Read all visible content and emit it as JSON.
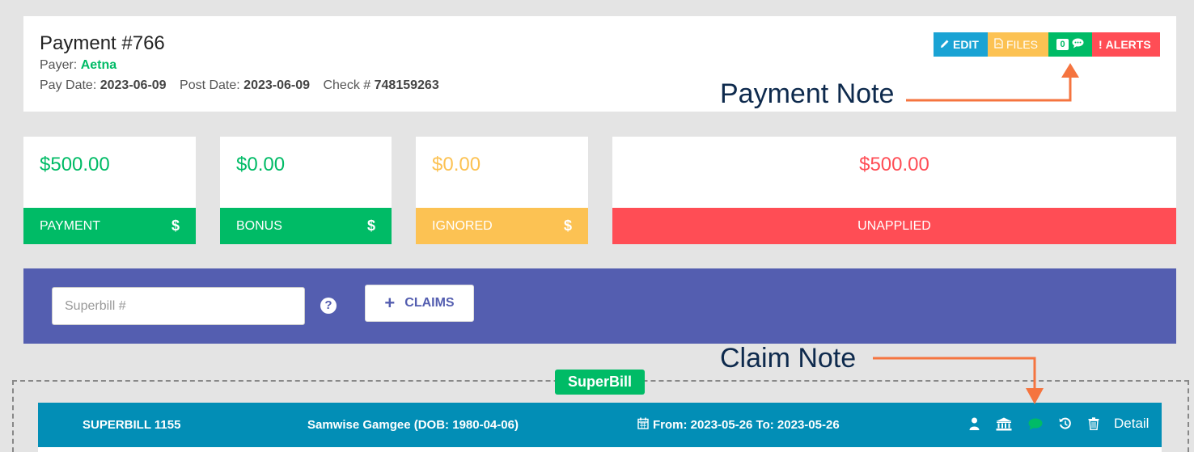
{
  "header": {
    "title": "Payment #766",
    "payer_label": "Payer:",
    "payer_value": "Aetna",
    "pay_date_label": "Pay Date:",
    "pay_date_value": "2023-06-09",
    "post_date_label": "Post Date:",
    "post_date_value": "2023-06-09",
    "check_label": "Check #",
    "check_value": "748159263",
    "buttons": {
      "edit": "EDIT",
      "files": "FILES",
      "note_count": "0",
      "alerts": "ALERTS"
    }
  },
  "annotations": {
    "payment_note": "Payment Note",
    "claim_note": "Claim Note",
    "arrow_color": "#f5743f"
  },
  "stats": [
    {
      "amount": "$500.00",
      "label": "PAYMENT",
      "symbol": "$",
      "color": "#00bb66"
    },
    {
      "amount": "$0.00",
      "label": "BONUS",
      "symbol": "$",
      "color": "#00bb66"
    },
    {
      "amount": "$0.00",
      "label": "IGNORED",
      "symbol": "$",
      "color": "#fcc253"
    },
    {
      "amount": "$500.00",
      "label": "UNAPPLIED",
      "color": "#ff4d55"
    }
  ],
  "toolbar": {
    "superbill_placeholder": "Superbill #",
    "help_symbol": "?",
    "claims_button": "CLAIMS",
    "background": "#545eb0"
  },
  "superbill": {
    "tag": "SuperBill",
    "id_label": "SUPERBILL 1155",
    "patient": "Samwise Gamgee (DOB: 1980-04-06)",
    "date_range": "From: 2023-05-26 To: 2023-05-26",
    "detail_label": "Detail",
    "icons": [
      "user-icon",
      "bank-icon",
      "comment-icon",
      "history-icon",
      "trash-icon"
    ],
    "row_color": "#028eb6"
  }
}
